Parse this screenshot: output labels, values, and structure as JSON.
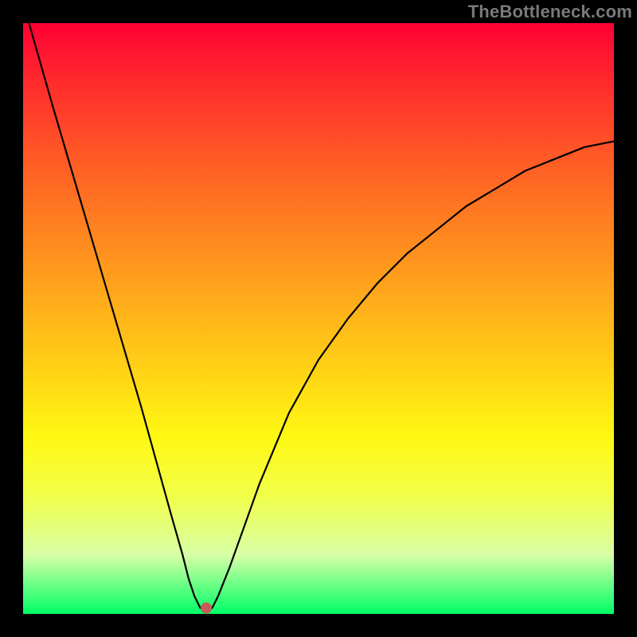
{
  "watermark": "TheBottleneck.com",
  "chart_data": {
    "type": "line",
    "title": "",
    "xlabel": "",
    "ylabel": "",
    "xlim": [
      0,
      100
    ],
    "ylim": [
      0,
      100
    ],
    "series": [
      {
        "name": "curve",
        "x": [
          1,
          5,
          10,
          15,
          20,
          25,
          27,
          28,
          29,
          30,
          31,
          32,
          33,
          35,
          40,
          45,
          50,
          55,
          60,
          65,
          70,
          75,
          80,
          85,
          90,
          95,
          100
        ],
        "y": [
          100,
          86,
          69,
          52,
          35,
          17,
          10,
          6,
          3,
          1,
          1,
          1,
          3,
          8,
          22,
          34,
          43,
          50,
          56,
          61,
          65,
          69,
          72,
          75,
          77,
          79,
          80
        ]
      }
    ],
    "marker": {
      "x": 31,
      "y": 1
    }
  },
  "colors": {
    "gradient_top": "#ff0033",
    "gradient_bottom": "#00ff66",
    "curve": "#000000",
    "marker": "#c85a5a",
    "frame": "#000000"
  }
}
